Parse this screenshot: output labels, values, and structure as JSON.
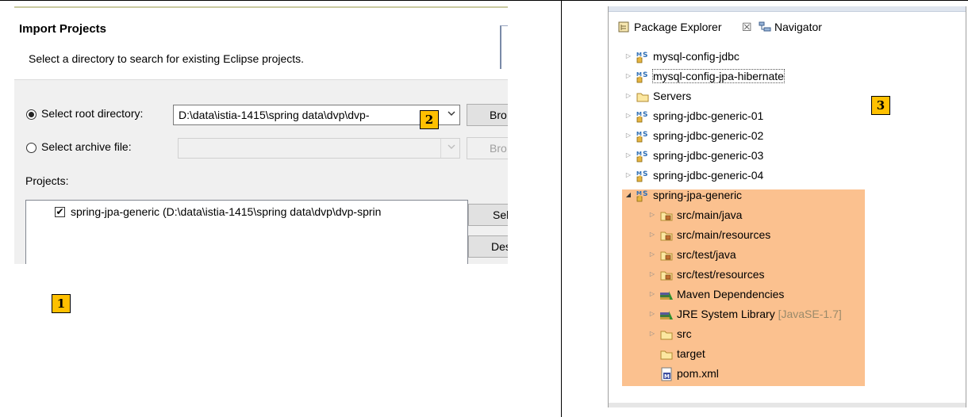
{
  "import_dialog": {
    "title": "Import Projects",
    "description": "Select a directory to search for existing Eclipse projects.",
    "root_dir": {
      "label": "Select root directory:",
      "value": "D:\\data\\istia-1415\\spring data\\dvp\\dvp-",
      "selected": true,
      "browse_label": "Bro"
    },
    "archive": {
      "label": "Select archive file:",
      "value": "",
      "selected": false,
      "browse_label": "Bro"
    },
    "projects_label": "Projects:",
    "projects": [
      {
        "label": "spring-jpa-generic (D:\\data\\istia-1415\\spring data\\dvp\\dvp-sprin",
        "checked": true
      }
    ],
    "select_all_label": "Sel",
    "deselect_all_label": "Dese"
  },
  "badges": {
    "one": "1",
    "two": "2",
    "three": "3"
  },
  "package_explorer": {
    "tabs": [
      {
        "label": "Package Explorer",
        "close": "☒"
      },
      {
        "label": "Navigator"
      }
    ],
    "items": [
      {
        "label": "mysql-config-jdbc",
        "icon": "maven-project-icon",
        "level": 0,
        "twisty": "▷"
      },
      {
        "label": "mysql-config-jpa-hibernate",
        "icon": "maven-project-icon",
        "level": 0,
        "twisty": "▷",
        "focused": true
      },
      {
        "label": "Servers",
        "icon": "folder-icon",
        "level": 0,
        "twisty": "▷"
      },
      {
        "label": "spring-jdbc-generic-01",
        "icon": "maven-project-icon",
        "level": 0,
        "twisty": "▷"
      },
      {
        "label": "spring-jdbc-generic-02",
        "icon": "maven-project-icon",
        "level": 0,
        "twisty": "▷"
      },
      {
        "label": "spring-jdbc-generic-03",
        "icon": "maven-project-icon",
        "level": 0,
        "twisty": "▷"
      },
      {
        "label": "spring-jdbc-generic-04",
        "icon": "maven-project-icon",
        "level": 0,
        "twisty": "▷"
      },
      {
        "label": "spring-jpa-generic",
        "icon": "maven-project-icon",
        "level": 0,
        "twisty": "◢"
      },
      {
        "label": "src/main/java",
        "icon": "source-folder-icon",
        "level": 1,
        "twisty": "▷"
      },
      {
        "label": "src/main/resources",
        "icon": "source-folder-icon",
        "level": 1,
        "twisty": "▷"
      },
      {
        "label": "src/test/java",
        "icon": "source-folder-icon",
        "level": 1,
        "twisty": "▷"
      },
      {
        "label": "src/test/resources",
        "icon": "source-folder-icon",
        "level": 1,
        "twisty": "▷"
      },
      {
        "label": "Maven Dependencies",
        "icon": "library-icon",
        "level": 1,
        "twisty": "▷"
      },
      {
        "label": "JRE System Library",
        "suffix": "[JavaSE-1.7]",
        "icon": "library-icon",
        "level": 1,
        "twisty": "▷"
      },
      {
        "label": "src",
        "icon": "folder-icon",
        "level": 1,
        "twisty": "▷"
      },
      {
        "label": "target",
        "icon": "folder-icon",
        "level": 1,
        "twisty": ""
      },
      {
        "label": "pom.xml",
        "icon": "xml-file-icon",
        "level": 1,
        "twisty": ""
      }
    ]
  },
  "colors": {
    "highlight": "#fbc18f",
    "badge": "#ffc000"
  }
}
